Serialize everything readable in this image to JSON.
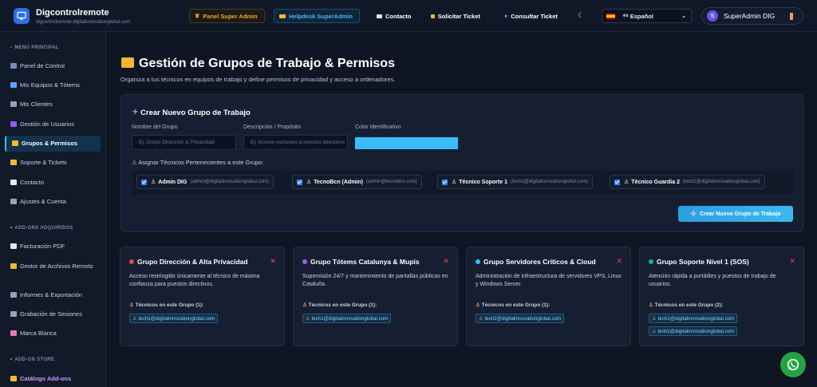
{
  "header": {
    "brand": "Digcontrolremote",
    "brand_url": "digcontrolremote.digitalinnovationglobal.com",
    "panel_admin": "Panel Super Admin",
    "helpdesk": "Helpdesk SuperAdmin",
    "contacto": "Contacto",
    "solicitar": "Solicitar Ticket",
    "consultar": "Consultar Ticket",
    "lang_code": "es",
    "lang": "Español",
    "avatar": "S",
    "user": "SuperAdmin DIG"
  },
  "sidebar": {
    "sec_main": "MENÚ PRINCIPAL",
    "items": [
      {
        "label": "Panel de Control",
        "color": "#7c8db5"
      },
      {
        "label": "Mis Equipos & Tótems",
        "color": "#60a5fa"
      },
      {
        "label": "Mis Clientes",
        "color": "#94a3b8"
      },
      {
        "label": "Gestión de Usuarios",
        "color": "#8b5cf6"
      },
      {
        "label": "Grupos & Permisos",
        "color": "#f5b82e"
      },
      {
        "label": "Soporte & Tickets",
        "color": "#f5b82e"
      },
      {
        "label": "Contacto",
        "color": "#e5e7eb"
      },
      {
        "label": "Ajustes & Cuenta",
        "color": "#9ca3af"
      }
    ],
    "sec_addons": "ADD-ONS ADQUIRIDOS",
    "addons": [
      {
        "label": "Facturación PDF",
        "color": "#e5e7eb"
      },
      {
        "label": "Gestor de Archivos Remoto",
        "color": "#f5b82e"
      },
      {
        "label": "Informes & Exportación",
        "color": "#94a3b8"
      },
      {
        "label": "Grabación de Sesiones",
        "color": "#94a3b8"
      },
      {
        "label": "Marca Blanca",
        "color": "#f472b6"
      }
    ],
    "sec_store": "ADD-ON STORE",
    "store": "Catálogo Add-ons"
  },
  "main": {
    "title": "Gestión de Grupos de Trabajo & Permisos",
    "subtitle": "Organiza a tus técnicos en equipos de trabajo y define permisos de privacidad y acceso a ordenadores.",
    "form": {
      "title": "Crear Nuevo Grupo de Trabajo",
      "name_label": "Nombre del Grupo",
      "name_placeholder": "Ej: Grupo Dirección & Privacidad",
      "desc_label": "Descripción / Propósito",
      "desc_placeholder": "Ej: Acceso exclusivo a puestos directivos",
      "color_label": "Color Identificativo",
      "color_value": "#38bdf8",
      "assign_label": "Asignar Técnicos Pertenecientes a este Grupo:",
      "techs": [
        {
          "name": "Admin DIG",
          "email": "(admin@digitalinnovationglobal.com)"
        },
        {
          "name": "TecnoBcn (Admin)",
          "email": "(admin@tecnobcn.com)"
        },
        {
          "name": "Técnico Soporte 1",
          "email": "(tech1@digitalinnovationglobal.com)"
        },
        {
          "name": "Técnico Guardia 2",
          "email": "(tech2@digitalinnovationglobal.com)"
        }
      ],
      "submit": "Crear Nuevo Grupo de Trabajo"
    },
    "cards": [
      {
        "title": "Grupo Dirección & Alta Privacidad",
        "color": "#ef4444",
        "desc": "Acceso restringido únicamente al técnico de máxima confianza para puestos directivos.",
        "label": "Técnicos en este Grupo (1):",
        "emails": [
          "tech1@digitalinnovationglobal.com"
        ]
      },
      {
        "title": "Grupo Tótems Catalunya & Mupis",
        "color": "#a855f7",
        "desc": "Supervisión 24/7 y mantenimiento de pantallas públicas en Cataluña.",
        "label": "Técnicos en este Grupo (1):",
        "emails": [
          "tech1@digitalinnovationglobal.com"
        ]
      },
      {
        "title": "Grupo Servidores Críticos & Cloud",
        "color": "#38bdf8",
        "desc": "Administración de infraestructura de servidores VPS, Linux y Windows Server.",
        "label": "Técnicos en este Grupo (1):",
        "emails": [
          "tech2@digitalinnovationglobal.com"
        ]
      },
      {
        "title": "Grupo Soporte Nivel 1 (SOS)",
        "color": "#10b981",
        "desc": "Atención rápida a portátiles y puestos de trabajo de usuarios.",
        "label": "Técnicos en este Grupo (2):",
        "emails": [
          "tech1@digitalinnovationglobal.com",
          "tech2@digitalinnovationglobal.com"
        ]
      }
    ]
  }
}
